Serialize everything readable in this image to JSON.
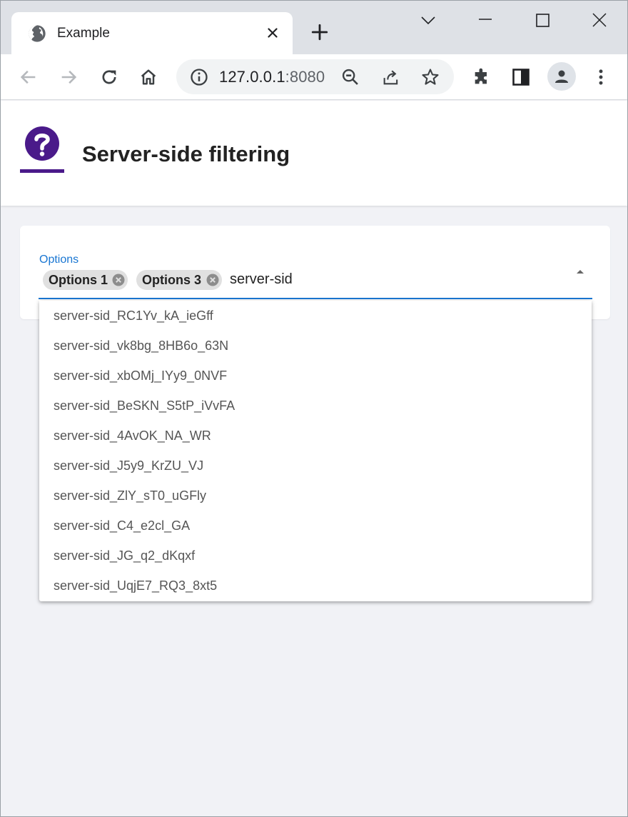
{
  "browser": {
    "tab_title": "Example",
    "url_host": "127.0.0.1",
    "url_port": ":8080"
  },
  "app": {
    "title": "Server-side filtering"
  },
  "field": {
    "label": "Options",
    "chips": [
      "Options 1",
      "Options 3"
    ],
    "input_value": "server-sid"
  },
  "dropdown": {
    "options": [
      "server-sid_RC1Yv_kA_ieGff",
      "server-sid_vk8bg_8HB6o_63N",
      "server-sid_xbOMj_IYy9_0NVF",
      "server-sid_BeSKN_S5tP_iVvFA",
      "server-sid_4AvOK_NA_WR",
      "server-sid_J5y9_KrZU_VJ",
      "server-sid_ZlY_sT0_uGFly",
      "server-sid_C4_e2cl_GA",
      "server-sid_JG_q2_dKqxf",
      "server-sid_UqjE7_RQ3_8xt5"
    ]
  },
  "colors": {
    "accent": "#1976d2",
    "logo": "#4a1a8a"
  },
  "icons": [
    "globe-icon",
    "close-icon",
    "plus-icon",
    "chevron-down-icon",
    "minimize-icon",
    "maximize-icon",
    "window-close-icon",
    "back-icon",
    "forward-icon",
    "reload-icon",
    "home-icon",
    "info-icon",
    "zoom-out-icon",
    "share-icon",
    "star-icon",
    "extensions-icon",
    "side-panel-icon",
    "profile-icon",
    "more-icon",
    "help-icon",
    "chip-remove-icon",
    "dropdown-caret-icon"
  ]
}
